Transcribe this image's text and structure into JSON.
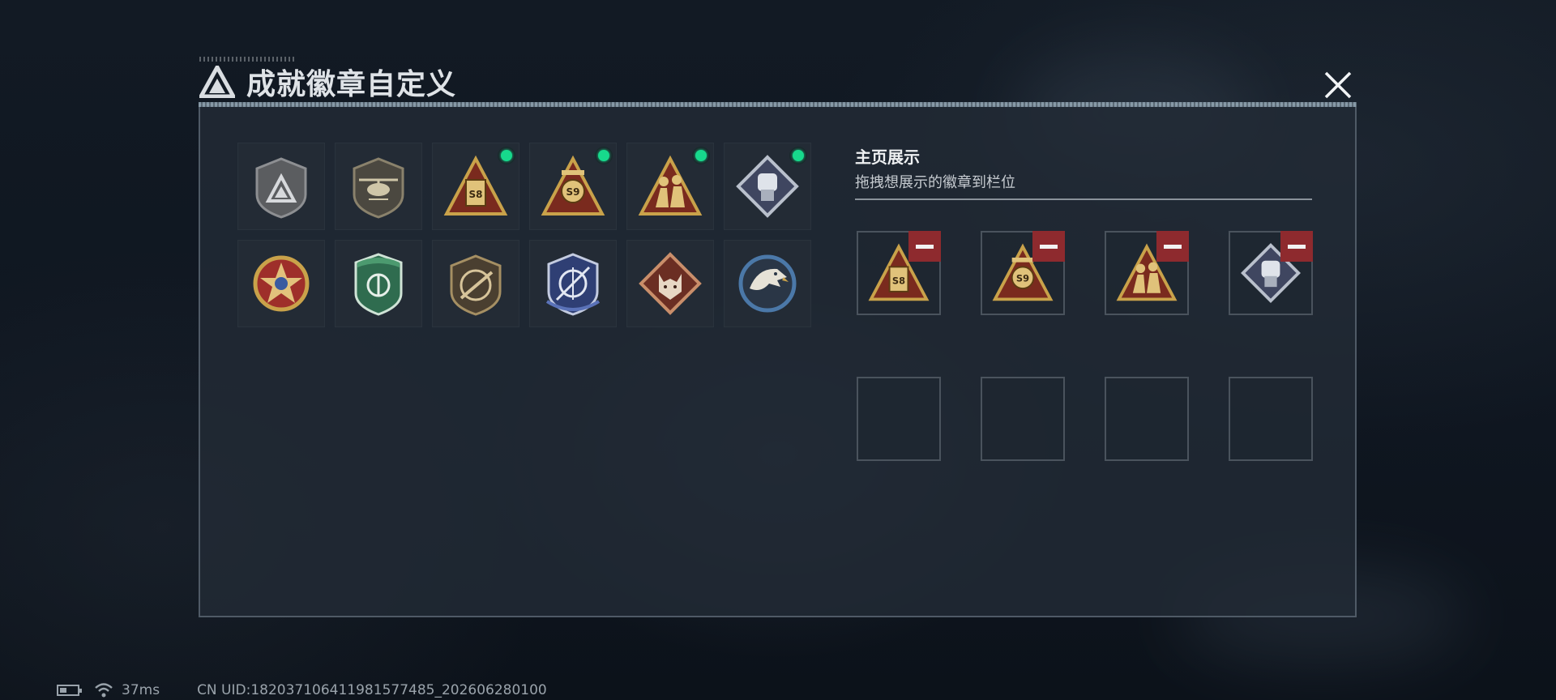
{
  "header": {
    "title": "成就徽章自定义"
  },
  "badges": [
    {
      "icon": "delta-shield-badge",
      "equipped": false
    },
    {
      "icon": "helicopter-badge",
      "equipped": false
    },
    {
      "icon": "s8-gold-triangle-badge",
      "equipped": true
    },
    {
      "icon": "s9-gold-triangle-badge",
      "equipped": true
    },
    {
      "icon": "soldiers-gold-triangle-badge",
      "equipped": true
    },
    {
      "icon": "fist-diamond-badge",
      "equipped": true
    },
    {
      "icon": "star-medal-badge",
      "equipped": false
    },
    {
      "icon": "green-shield-badge",
      "equipped": false
    },
    {
      "icon": "rifle-shield-badge",
      "equipped": false
    },
    {
      "icon": "blue-crosshair-shield-badge",
      "equipped": false
    },
    {
      "icon": "wolf-diamond-badge",
      "equipped": false
    },
    {
      "icon": "eagle-round-badge",
      "equipped": false
    }
  ],
  "showcase": {
    "title": "主页展示",
    "subtitle": "拖拽想展示的徽章到栏位",
    "slots": [
      {
        "icon": "s8-gold-triangle-badge"
      },
      {
        "icon": "s9-gold-triangle-badge"
      },
      {
        "icon": "soldiers-gold-triangle-badge"
      },
      {
        "icon": "fist-diamond-badge"
      },
      {
        "icon": ""
      },
      {
        "icon": ""
      },
      {
        "icon": ""
      },
      {
        "icon": ""
      }
    ]
  },
  "status": {
    "ping": "37ms",
    "uid": "CN UID:182037106411981577485_202606280100"
  },
  "colors": {
    "equipped_dot": "#17d98c",
    "remove_button": "#8e2a2e",
    "gold": "#c9a24a"
  }
}
